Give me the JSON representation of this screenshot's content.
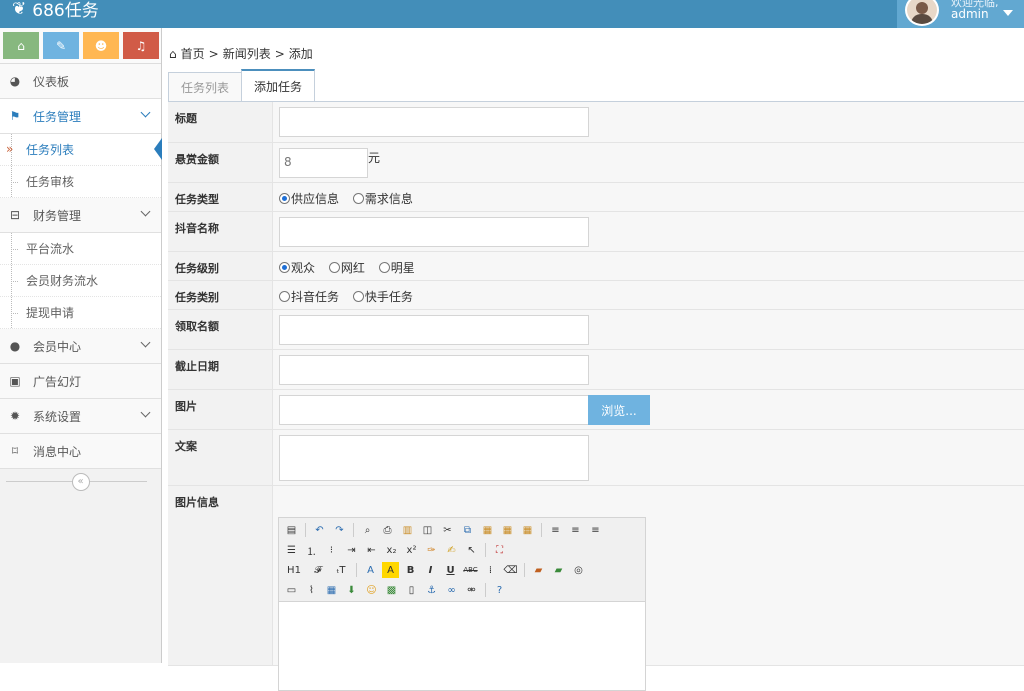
{
  "app": {
    "title": "686任务"
  },
  "user": {
    "welcome": "欢迎光临,",
    "name": "admin"
  },
  "shortcuts": [
    {
      "name": "home",
      "color": "#87b87f",
      "glyph": "⌂"
    },
    {
      "name": "pencil",
      "color": "#6fb3e0",
      "glyph": "✎"
    },
    {
      "name": "users",
      "color": "#ffb752",
      "glyph": "☻"
    },
    {
      "name": "bell",
      "color": "#d15b47",
      "glyph": "♫"
    }
  ],
  "sidebar": {
    "dashboard": "仪表板",
    "task_mgmt": "任务管理",
    "task_list": "任务列表",
    "task_review": "任务审核",
    "finance_mgmt": "财务管理",
    "platform_flow": "平台流水",
    "member_flow": "会员财务流水",
    "withdraw": "提现申请",
    "member_center": "会员中心",
    "ads": "广告幻灯",
    "settings": "系统设置",
    "messages": "消息中心"
  },
  "breadcrumb": {
    "home": "首页",
    "sep": ">",
    "list": "新闻列表",
    "add": "添加"
  },
  "tabs": {
    "list": "任务列表",
    "add": "添加任务"
  },
  "form": {
    "title_label": "标题",
    "reward_label": "悬赏金额",
    "reward_value": "8",
    "reward_unit": "元",
    "type_label": "任务类型",
    "type_opt1": "供应信息",
    "type_opt2": "需求信息",
    "douyin_label": "抖音名称",
    "level_label": "任务级别",
    "level_opt1": "观众",
    "level_opt2": "网红",
    "level_opt3": "明星",
    "category_label": "任务类别",
    "cat_opt1": "抖音任务",
    "cat_opt2": "快手任务",
    "quota_label": "领取名额",
    "deadline_label": "截止日期",
    "image_label": "图片",
    "browse_label": "浏览...",
    "copy_label": "文案",
    "imginfo_label": "图片信息"
  },
  "editor": {
    "h1": "H1",
    "font": "𝓕",
    "size": "ₜT",
    "color": "A",
    "bold": "B",
    "italic": "I",
    "underline": "U",
    "strike": "ABC"
  }
}
